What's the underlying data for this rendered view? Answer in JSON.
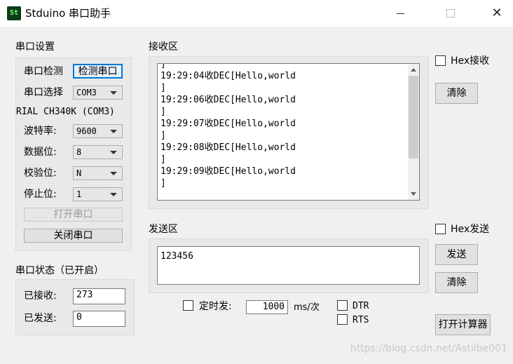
{
  "window": {
    "title": "Stduino 串口助手",
    "icon_text": "St",
    "icon_bg": "#0c3d1a",
    "icon_fg": "#7bff6f"
  },
  "serial_settings": {
    "title": "串口设置",
    "detect_label": "串口检测",
    "detect_button": "检测串口",
    "select_label": "串口选择",
    "select_value": "COM3",
    "port_desc": "RIAL CH340K (COM3)",
    "baud_label": "波特率:",
    "baud_value": "9600",
    "databits_label": "数据位:",
    "databits_value": "8",
    "parity_label": "校验位:",
    "parity_value": "N",
    "stopbits_label": "停止位:",
    "stopbits_value": "1",
    "open_button": "打开串口",
    "close_button": "关闭串口"
  },
  "serial_status": {
    "title": "串口状态（已开启）",
    "received_label": "已接收:",
    "received_value": "273",
    "sent_label": "已发送:",
    "sent_value": "0"
  },
  "receive": {
    "title": "接收区",
    "hex_label": "Hex接收",
    "clear_button": "清除",
    "lines": [
      "]",
      "19:29:04收DEC[Hello,world",
      "]",
      "19:29:06收DEC[Hello,world",
      "]",
      "19:29:07收DEC[Hello,world",
      "]",
      "19:29:08收DEC[Hello,world",
      "]",
      "19:29:09收DEC[Hello,world",
      "]"
    ]
  },
  "send": {
    "title": "发送区",
    "hex_label": "Hex发送",
    "text": "123456",
    "send_button": "发送",
    "clear_button": "清除"
  },
  "timer": {
    "label": "定时发:",
    "interval": "1000",
    "unit": "ms/次",
    "dtr_label": "DTR",
    "rts_label": "RTS",
    "calc_button": "打开计算器"
  },
  "watermark": "https://blog.csdn.net/Astilbe001",
  "colors": {
    "focus_border": "#0078d7",
    "group_bg": "#e9e9e9",
    "window_bg": "#f0f0f0"
  }
}
